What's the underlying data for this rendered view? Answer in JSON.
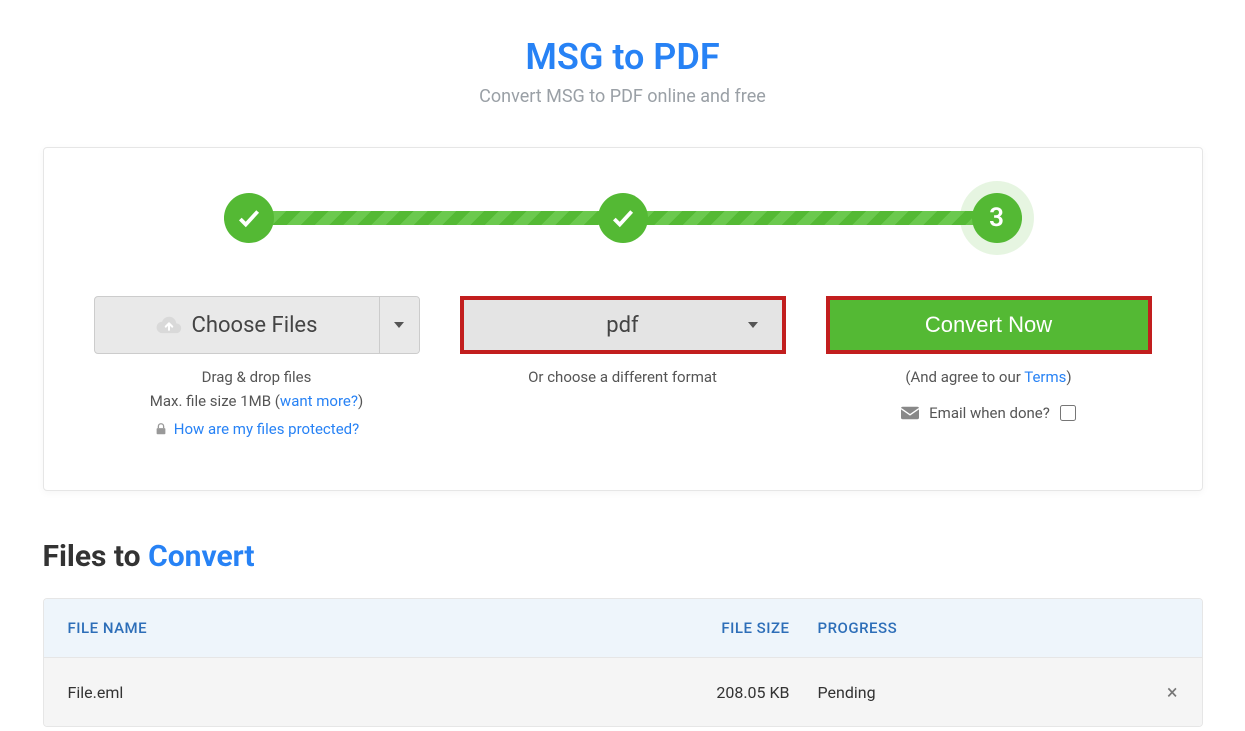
{
  "header": {
    "title": "MSG to PDF",
    "subtitle": "Convert MSG to PDF online and free"
  },
  "stepper": {
    "step1_done": true,
    "step2_done": true,
    "step3_label": "3"
  },
  "upload": {
    "choose_label": "Choose Files",
    "hint_drag": "Drag & drop files",
    "hint_max_prefix": "Max. file size 1MB (",
    "hint_max_link": "want more?",
    "hint_max_suffix": ")",
    "hint_protected": "How are my files protected?"
  },
  "format": {
    "selected": "pdf",
    "hint": "Or choose a different format"
  },
  "convert": {
    "button_label": "Convert Now",
    "agree_prefix": "(And agree to our ",
    "terms_link": "Terms",
    "agree_suffix": ")",
    "email_label": "Email when done?",
    "email_checked": false
  },
  "files_section": {
    "heading_plain": "Files to ",
    "heading_accent": "Convert",
    "columns": {
      "name": "FILE NAME",
      "size": "FILE SIZE",
      "progress": "PROGRESS"
    },
    "rows": [
      {
        "name": "File.eml",
        "size": "208.05 KB",
        "progress": "Pending"
      }
    ]
  },
  "icons": {
    "upload": "upload-cloud",
    "lock": "lock",
    "mail": "mail",
    "close": "×"
  }
}
